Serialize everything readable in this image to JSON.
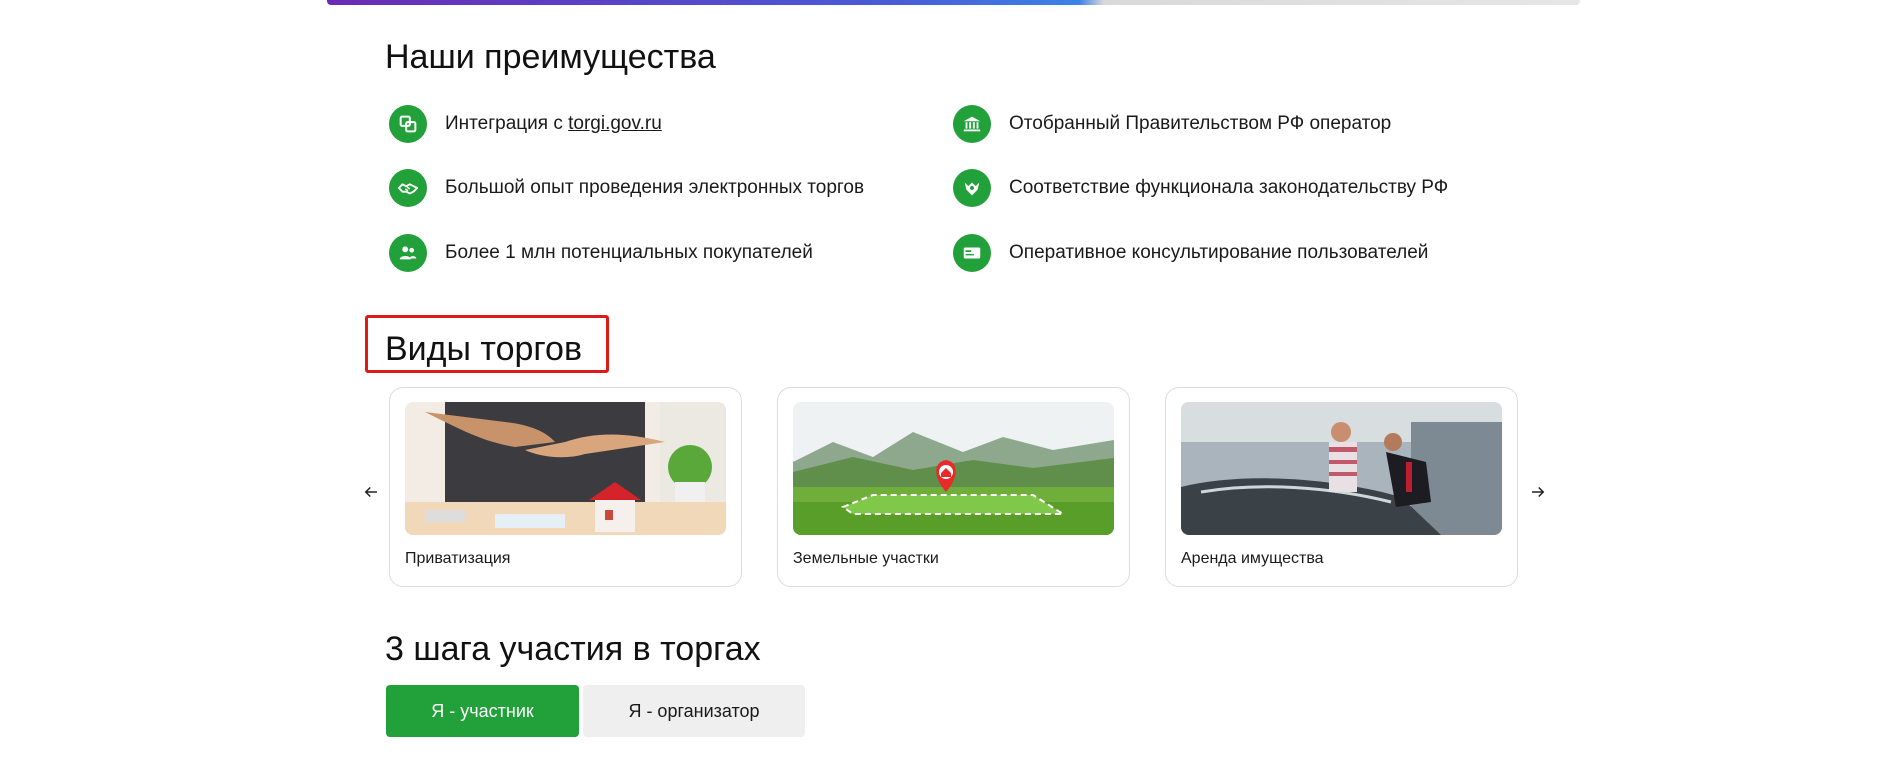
{
  "advantages": {
    "title": "Наши преимущества",
    "items": [
      {
        "icon": "integration-icon",
        "text_before": "Интеграция с ",
        "link": "torgi.gov.ru"
      },
      {
        "icon": "government-building-icon",
        "text": "Отобранный Правительством РФ оператор"
      },
      {
        "icon": "handshake-icon",
        "text": "Большой опыт проведения электронных торгов"
      },
      {
        "icon": "emblem-icon",
        "text": "Соответствие функционала законодательству РФ"
      },
      {
        "icon": "users-icon",
        "text": "Более 1 млн потенциальных покупателей"
      },
      {
        "icon": "support-card-icon",
        "text": "Оперативное консультирование пользователей"
      }
    ]
  },
  "auction_types": {
    "title": "Виды торгов",
    "cards": [
      {
        "label": "Приватизация",
        "image": "handshake-house-photo"
      },
      {
        "label": "Земельные участки",
        "image": "land-plot-photo"
      },
      {
        "label": "Аренда имущества",
        "image": "car-rental-photo"
      }
    ]
  },
  "steps": {
    "title": "3 шага участия в торгах",
    "participant_label": "Я - участник",
    "organizer_label": "Я - организатор"
  },
  "colors": {
    "accent_green": "#22a03a",
    "highlight_red": "#e01818"
  }
}
